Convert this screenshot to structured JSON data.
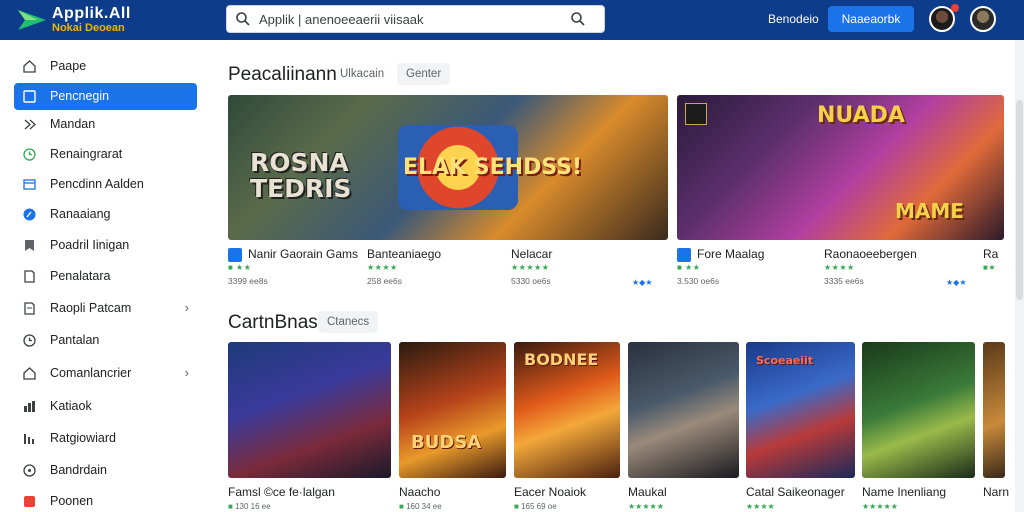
{
  "brand": {
    "title": "Applik.All",
    "subtitle": "Nokai Deoean"
  },
  "search": {
    "value": "Applik | anenoeeaerii viisaak",
    "placeholder": "Applik | anenoeeaerii viisaak"
  },
  "header": {
    "link_label": "Benodeio",
    "button_label": "Naaeaorbk"
  },
  "sidebar": {
    "items": [
      {
        "label": "Paape"
      },
      {
        "label": "Pencnegin"
      },
      {
        "label": "Mandan"
      },
      {
        "label": "Renaingrarat"
      },
      {
        "label": "Pencdinn Aalden"
      },
      {
        "label": "Ranaaiang"
      },
      {
        "label": "Poadril Iinigan"
      },
      {
        "label": "Penalatara"
      },
      {
        "label": "Raopli Patcam"
      },
      {
        "label": "Pantalan"
      },
      {
        "label": "Comanlancrier"
      },
      {
        "label": "Katiaok"
      },
      {
        "label": "Ratgiowiard"
      },
      {
        "label": "Bandrdain"
      },
      {
        "label": "Poonen"
      }
    ]
  },
  "section1": {
    "title": "Peacaliinann",
    "tab_label": "Ulkacain",
    "chip_label": "Genter",
    "banner1_text": "ROSNA\nTEDRIS",
    "banner1_center": "ELAK SEHDSS!",
    "banner2_text_top": "NUADA",
    "banner2_text_bottom": "MAME",
    "apps": [
      {
        "name": "Nanir Gaorain Gams",
        "meta": "3399 ee8s"
      },
      {
        "name": "Banteaniaego",
        "meta": "258 ee6s"
      },
      {
        "name": "Nelacar",
        "meta": "5330 oe6s"
      },
      {
        "name": "Fore Maalag",
        "meta": "3.530 oe6s"
      },
      {
        "name": "Raonaoeebergen",
        "meta": "3335 ee6s"
      },
      {
        "name": "Ra",
        "meta": ""
      }
    ]
  },
  "section2": {
    "title": "CartnBnas",
    "chip_label": "Ctanecs",
    "cards": [
      {
        "name": "Famsl ©ce fe·lalgan",
        "meta": "130 16 ee",
        "art": ""
      },
      {
        "name": "Naacho",
        "meta": "160 34 ee",
        "art": "BUDSA"
      },
      {
        "name": "Eacer Noaiok",
        "meta": "165 69 oe",
        "art": "BODNEE"
      },
      {
        "name": "Maukal",
        "meta": "",
        "art": ""
      },
      {
        "name": "Catal Saikeonager",
        "meta": "",
        "art": "Scoeaeiit"
      },
      {
        "name": "Name Inenliang",
        "meta": "",
        "art": ""
      },
      {
        "name": "Narn",
        "meta": "",
        "art": ""
      }
    ]
  },
  "icons": {
    "search": "search-icon",
    "brand": "logo-arrow-icon"
  },
  "colors": {
    "header_bg": "#0d3c8a",
    "accent": "#1a73e8",
    "rating": "#34a853"
  }
}
